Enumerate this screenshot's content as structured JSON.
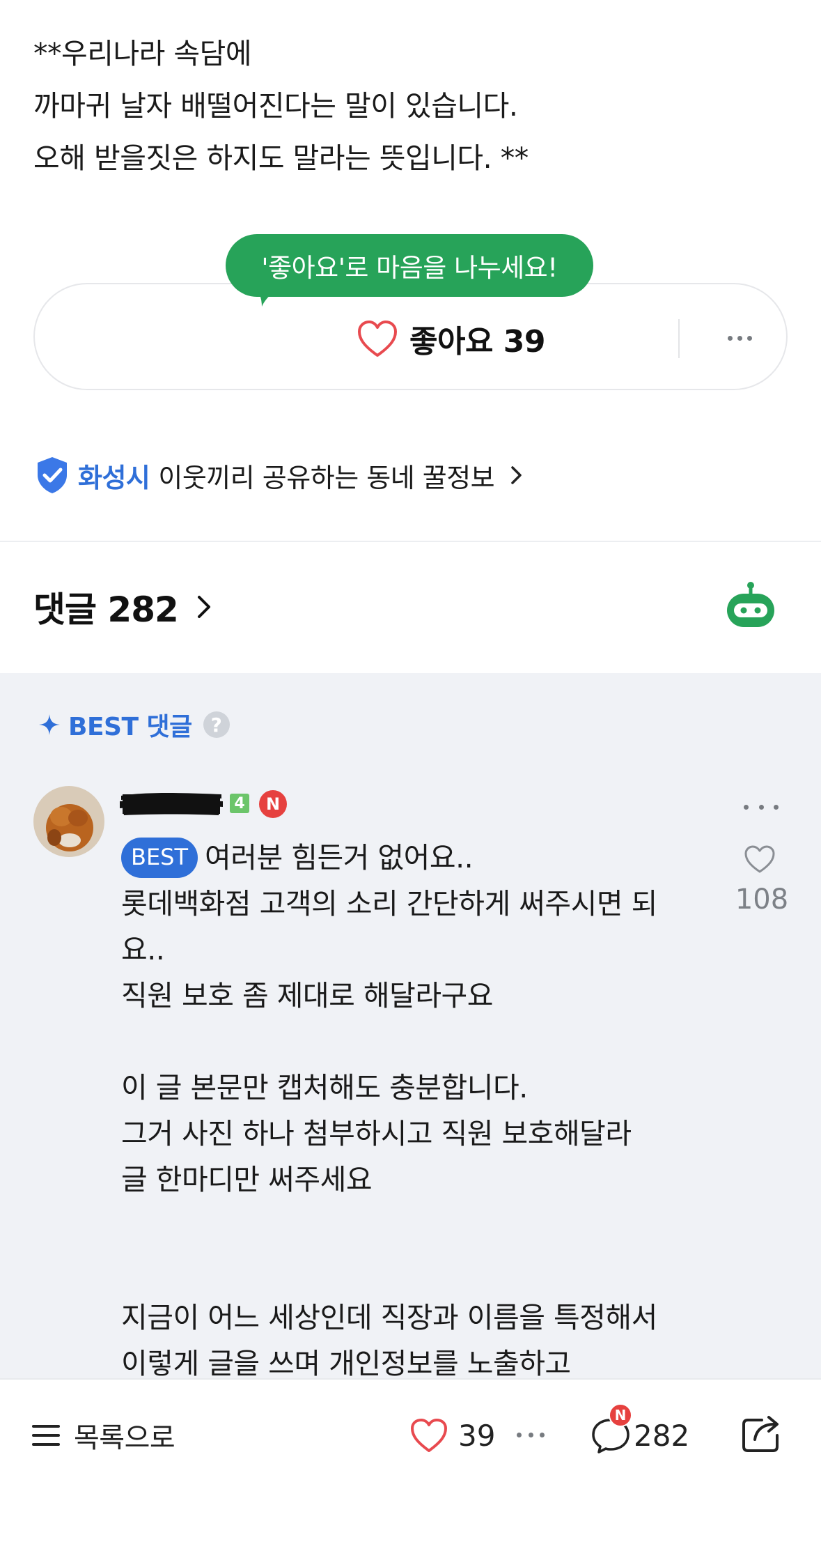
{
  "article": {
    "lines": [
      "**우리나라 속담에",
      "까마귀 날자 배떨어진다는 말이 있습니다.",
      "오해 받을짓은 하지도 말라는 뜻입니다. **"
    ]
  },
  "like_prompt": {
    "tooltip": "'좋아요'로 마음을 나누세요!",
    "label": "좋아요 39"
  },
  "community": {
    "city": "화성시",
    "description": "이웃끼리 공유하는 동네 꿀정보"
  },
  "comments_header": {
    "title": "댓글 282"
  },
  "best_section": {
    "title": "BEST 댓글",
    "help": "?"
  },
  "best_comment": {
    "level": "4",
    "n_badge": "N",
    "best_pill": "BEST",
    "lines": [
      "여러분 힘든거 없어요..",
      "롯데백화점 고객의 소리 간단하게 써주시면 되",
      "요..",
      "직원 보호 좀 제대로 해달라구요",
      "",
      "이 글 본문만 캡처해도 충분합니다.",
      "그거 사진 하나 첨부하시고 직원 보호해달라",
      "글 한마디만 써주세요",
      "",
      "",
      "지금이 어느 세상인데 직장과 이름을 특정해서",
      "이렇게 글을 쓰며 개인정보를 노출하고"
    ],
    "like_count": "108"
  },
  "bottom_bar": {
    "list_label": "목록으로",
    "like_count": "39",
    "comment_badge": "N",
    "comment_count": "282"
  },
  "colors": {
    "accent_green": "#27a359",
    "accent_blue": "#2f6fd8",
    "badge_red": "#e6413f",
    "heart_red": "#e84a4f",
    "comments_bg": "#f0f2f6"
  },
  "icons": [
    "heart-icon",
    "more-dots-icon",
    "verified-badge-icon",
    "chevron-right-icon",
    "bot-icon",
    "sparkle-icon",
    "help-icon",
    "menu-icon",
    "comment-bubble-icon",
    "share-icon"
  ]
}
